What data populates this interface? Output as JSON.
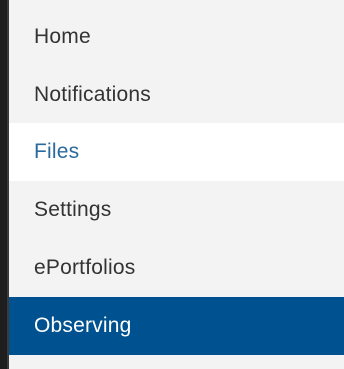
{
  "nav": {
    "items": [
      {
        "label": "Home",
        "state": "normal"
      },
      {
        "label": "Notifications",
        "state": "normal"
      },
      {
        "label": "Files",
        "state": "selected"
      },
      {
        "label": "Settings",
        "state": "normal"
      },
      {
        "label": "ePortfolios",
        "state": "normal"
      },
      {
        "label": "Observing",
        "state": "active"
      }
    ]
  },
  "colors": {
    "menu_background": "#f3f3f3",
    "selected_background": "#ffffff",
    "selected_text": "#2b6a9c",
    "active_background": "#00518f",
    "active_text": "#ffffff",
    "text": "#333333",
    "left_bar": "#1e1e1e"
  }
}
